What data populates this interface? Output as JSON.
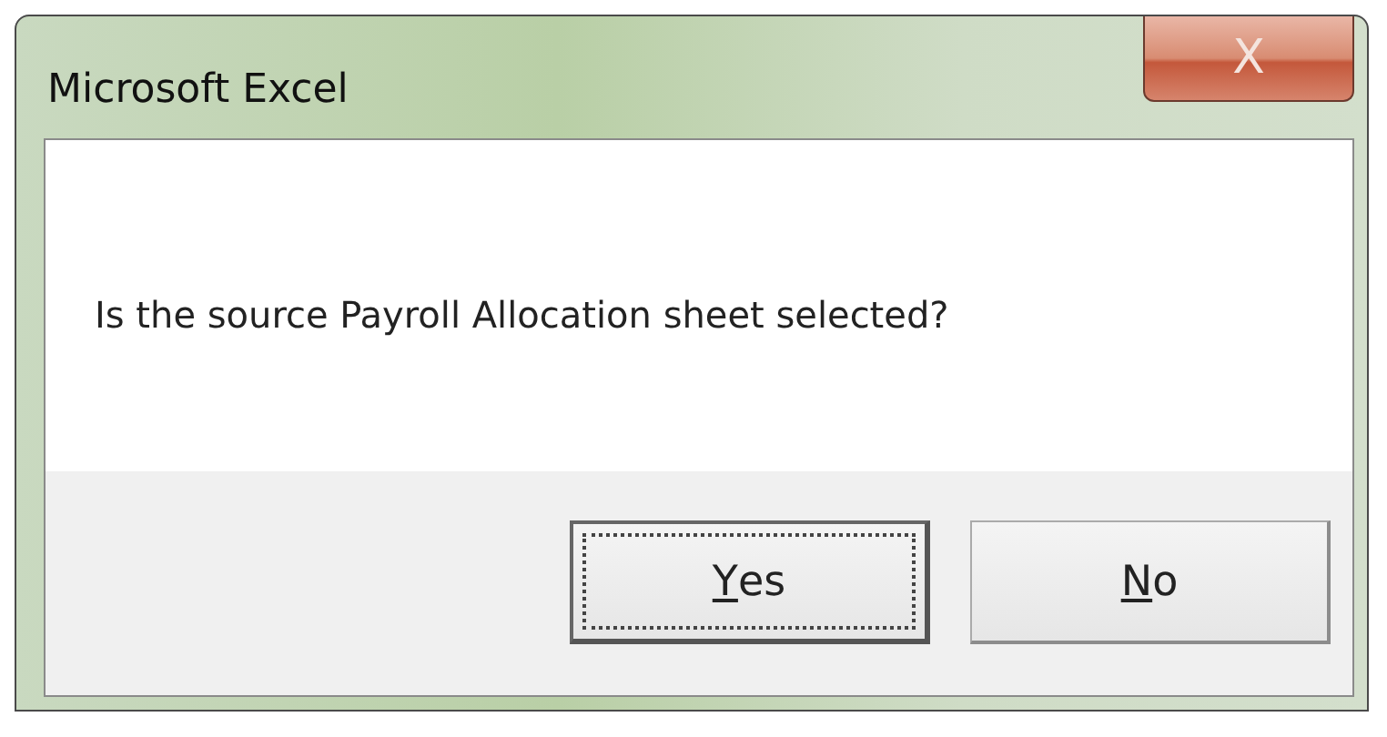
{
  "window": {
    "title": "Microsoft Excel",
    "close_label": "X"
  },
  "message": "Is the source Payroll Allocation sheet selected?",
  "buttons": [
    {
      "label": "Yes",
      "default": true,
      "access_key": true
    },
    {
      "label": "No",
      "default": false,
      "access_key": true
    }
  ]
}
